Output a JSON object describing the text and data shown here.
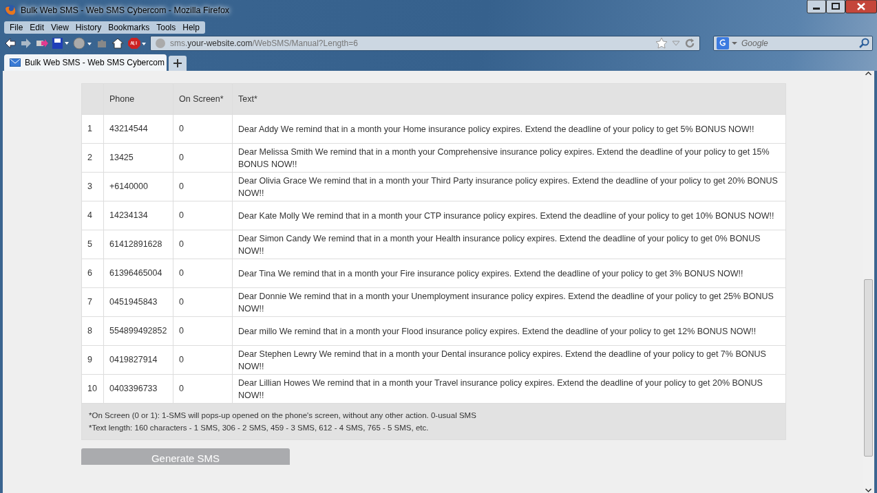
{
  "window": {
    "title": "Bulk Web SMS - Web SMS Cybercom - Mozilla Firefox"
  },
  "menu": [
    "File",
    "Edit",
    "View",
    "History",
    "Bookmarks",
    "Tools",
    "Help"
  ],
  "address_bar": {
    "prefix": "sms.",
    "domain": "your-website.com",
    "path": "/WebSMS/Manual?Length=6"
  },
  "search": {
    "placeholder": "Google"
  },
  "tabs": [
    {
      "label": "Bulk Web SMS - Web SMS Cybercom",
      "selected": true
    }
  ],
  "table": {
    "columns": [
      "Phone",
      "On Screen*",
      "Text*"
    ],
    "rows": [
      {
        "index": "1",
        "phone": "43214544",
        "on_screen": "0",
        "text": "Dear Addy We remind that in a month your Home insurance policy expires. Extend the deadline of your policy to get 5% BONUS NOW!!"
      },
      {
        "index": "2",
        "phone": "13425",
        "on_screen": "0",
        "text": "Dear Melissa Smith We remind that in a month your Comprehensive insurance policy expires. Extend the deadline of your policy to get 15% BONUS NOW!!"
      },
      {
        "index": "3",
        "phone": "+6140000",
        "on_screen": "0",
        "text": "Dear Olivia Grace We remind that in a month your Third Party insurance policy expires. Extend the deadline of your policy to get 20% BONUS NOW!!"
      },
      {
        "index": "4",
        "phone": "14234134",
        "on_screen": "0",
        "text": "Dear Kate Molly We remind that in a month your CTP insurance policy expires. Extend the deadline of your policy to get 10% BONUS NOW!!"
      },
      {
        "index": "5",
        "phone": "61412891628",
        "on_screen": "0",
        "text": "Dear Simon Candy We remind that in a month your Health insurance policy expires. Extend the deadline of your policy to get 0% BONUS NOW!!"
      },
      {
        "index": "6",
        "phone": "61396465004",
        "on_screen": "0",
        "text": "Dear Tina We remind that in a month your Fire insurance policy expires. Extend the deadline of your policy to get 3% BONUS NOW!!"
      },
      {
        "index": "7",
        "phone": "0451945843",
        "on_screen": "0",
        "text": "Dear Donnie We remind that in a month your Unemployment insurance policy expires. Extend the deadline of your policy to get 25% BONUS NOW!!"
      },
      {
        "index": "8",
        "phone": "554899492852",
        "on_screen": "0",
        "text": "Dear millo We remind that in a month your Flood insurance policy expires. Extend the deadline of your policy to get 12% BONUS NOW!!"
      },
      {
        "index": "9",
        "phone": "0419827914",
        "on_screen": "0",
        "text": "Dear Stephen Lewry We remind that in a month your Dental insurance policy expires. Extend the deadline of your policy to get 7% BONUS NOW!!"
      },
      {
        "index": "10",
        "phone": "0403396733",
        "on_screen": "0",
        "text": "Dear Lillian Howes We remind that in a month your Travel insurance policy expires. Extend the deadline of your policy to get 20% BONUS NOW!!"
      }
    ],
    "notes": [
      "*On Screen (0 or 1): 1-SMS will pops-up opened on the phone's screen, without any other action. 0-usual SMS",
      "*Text length: 160 characters - 1 SMS, 306 - 2 SMS, 459 - 3 SMS, 612 - 4 SMS, 765 - 5 SMS, etc."
    ]
  },
  "generate_button": {
    "label": "Generate SMS",
    "disabled": true
  }
}
